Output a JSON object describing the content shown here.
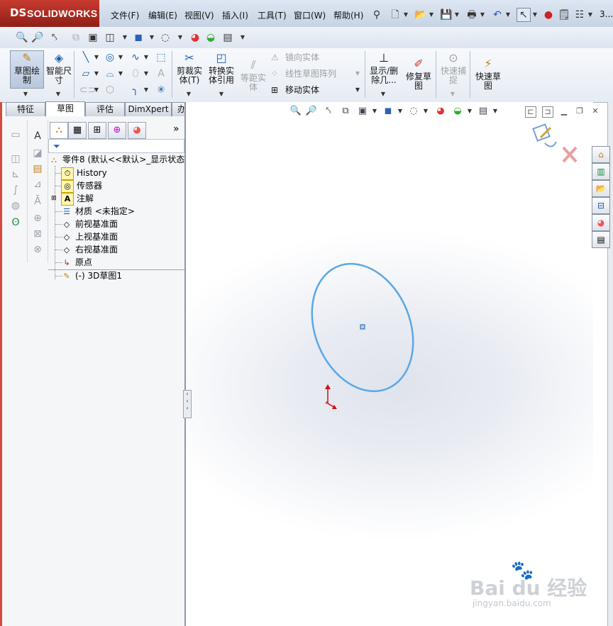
{
  "app": {
    "logo_text": "SOLIDWORKS",
    "logo_mark": "DS",
    "window_suffix": "3..."
  },
  "menu": {
    "items": [
      "文件(F)",
      "编辑(E)",
      "视图(V)",
      "插入(I)",
      "工具(T)",
      "窗口(W)",
      "帮助(H)"
    ]
  },
  "commands": {
    "sketch": "草图绘\n制",
    "smart_dim": "智能尺\n寸",
    "trim": "剪裁实\n体(T)",
    "convert": "转换实\n体引用",
    "offset": "等距实\n体",
    "mirror": "镜向实体",
    "linear_pattern": "线性草图阵列",
    "move": "移动实体",
    "show_delete": "显示/删\n除几...",
    "repair": "修复草\n图",
    "quick_snap": "快速捕\n捉",
    "rapid_sketch": "快速草\n图"
  },
  "tabs": [
    "特征",
    "草图",
    "评估",
    "DimXpert",
    "办公室产品"
  ],
  "active_tab": "草图",
  "tree": {
    "root": "零件8 (默认<<默认>_显示状态",
    "items": [
      {
        "label": "History",
        "icon": "history-icon"
      },
      {
        "label": "传感器",
        "icon": "sensor-icon"
      },
      {
        "label": "注解",
        "icon": "annotation-icon"
      },
      {
        "label": "材质 <未指定>",
        "icon": "material-icon"
      },
      {
        "label": "前视基准面",
        "icon": "plane-icon"
      },
      {
        "label": "上视基准面",
        "icon": "plane-icon"
      },
      {
        "label": "右视基准面",
        "icon": "plane-icon"
      },
      {
        "label": "原点",
        "icon": "origin-icon"
      },
      {
        "label": "(-) 3D草图1",
        "icon": "3d-sketch-icon"
      }
    ]
  },
  "panel": {
    "expand": "»"
  },
  "watermark": {
    "brand": "Bai du 经验",
    "url": "jingyan.baidu.com"
  },
  "colors": {
    "brand_red": "#c83a2f",
    "ellipse": "#5aa8e6",
    "origin": "#cc1111"
  }
}
